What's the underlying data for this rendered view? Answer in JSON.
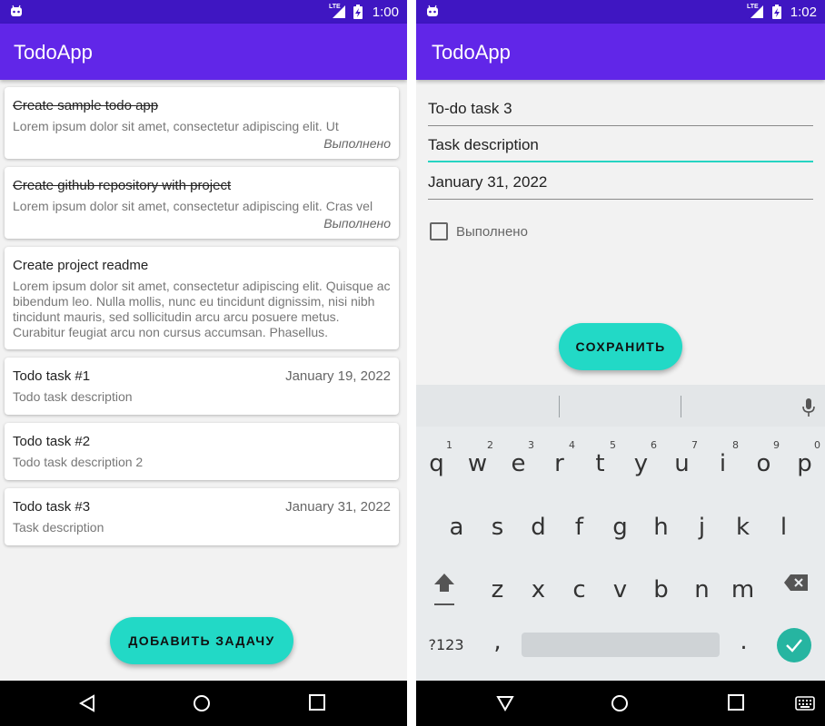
{
  "left": {
    "status": {
      "time": "1:00",
      "network": "LTE"
    },
    "app_title": "TodoApp",
    "todos": [
      {
        "title": "Create sample todo app",
        "desc": "Lorem ipsum dolor sit amet, consectetur adipiscing elit. Ut",
        "status": "Выполнено",
        "done": true
      },
      {
        "title": "Create github repository with project",
        "desc": "Lorem ipsum dolor sit amet, consectetur adipiscing elit. Cras vel",
        "status": "Выполнено",
        "done": true
      },
      {
        "title": "Create project readme",
        "desc": "Lorem ipsum dolor sit amet, consectetur adipiscing elit. Quisque ac bibendum leo. Nulla mollis, nunc eu tincidunt dignissim, nisi nibh tincidunt mauris, sed sollicitudin arcu arcu posuere metus. Curabitur feugiat arcu non cursus accumsan. Phasellus.",
        "done": false
      },
      {
        "title": "Todo task #1",
        "desc": "Todo task description",
        "date": "January 19, 2022",
        "done": false
      },
      {
        "title": "Todo task #2",
        "desc": "Todo task description 2",
        "done": false
      },
      {
        "title": "Todo task #3",
        "desc": "Task description",
        "date": "January 31, 2022",
        "done": false
      }
    ],
    "add_button": "ДОБАВИТЬ ЗАДАЧУ"
  },
  "right": {
    "status": {
      "time": "1:02",
      "network": "LTE"
    },
    "app_title": "TodoApp",
    "form": {
      "title_value": "To-do task 3",
      "description_value": "Task description",
      "date_value": "January 31, 2022",
      "done_label": "Выполнено",
      "done_checked": false
    },
    "save_button": "СОХРАНИТЬ",
    "keyboard": {
      "row1": [
        "q",
        "w",
        "e",
        "r",
        "t",
        "y",
        "u",
        "i",
        "o",
        "p"
      ],
      "row1_nums": [
        "1",
        "2",
        "3",
        "4",
        "5",
        "6",
        "7",
        "8",
        "9",
        "0"
      ],
      "row2": [
        "a",
        "s",
        "d",
        "f",
        "g",
        "h",
        "j",
        "k",
        "l"
      ],
      "row3": [
        "z",
        "x",
        "c",
        "v",
        "b",
        "n",
        "m"
      ],
      "symbols_key": "?123",
      "comma": ",",
      "period": "."
    }
  },
  "colors": {
    "status_bar": "#3f16c2",
    "app_bar": "#6126e8",
    "accent": "#22d9c6",
    "enter_key": "#26b5a1"
  }
}
